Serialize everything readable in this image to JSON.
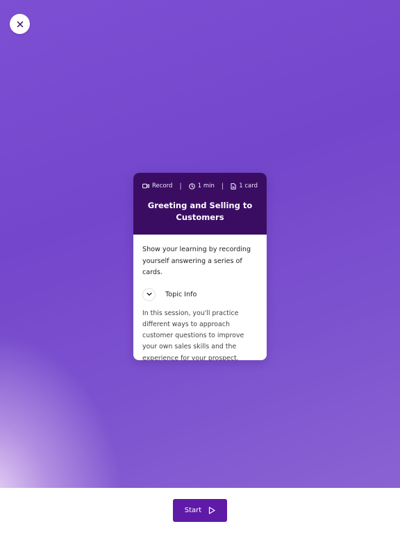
{
  "header": {
    "close_icon": "close-icon"
  },
  "card": {
    "meta": {
      "type_label": "Record",
      "type_icon": "video-icon",
      "duration_label": "1 min",
      "duration_icon": "clock-icon",
      "cards_label": "1 card",
      "cards_icon": "document-icon",
      "separator": "|"
    },
    "title": "Greeting and Selling to Customers",
    "lead": "Show your learning by recording yourself answering a series of cards.",
    "topic": {
      "label": "Topic Info",
      "icon": "chevron-down-icon"
    },
    "description": "In this session, you'll practice different ways to approach customer questions to improve your own sales skills and the experience for your prospect."
  },
  "footer": {
    "start_label": "Start",
    "start_icon": "play-icon"
  },
  "colors": {
    "background_purple": "#7446cb",
    "card_header": "#3a0d63",
    "start_button": "#5f1aa8"
  }
}
